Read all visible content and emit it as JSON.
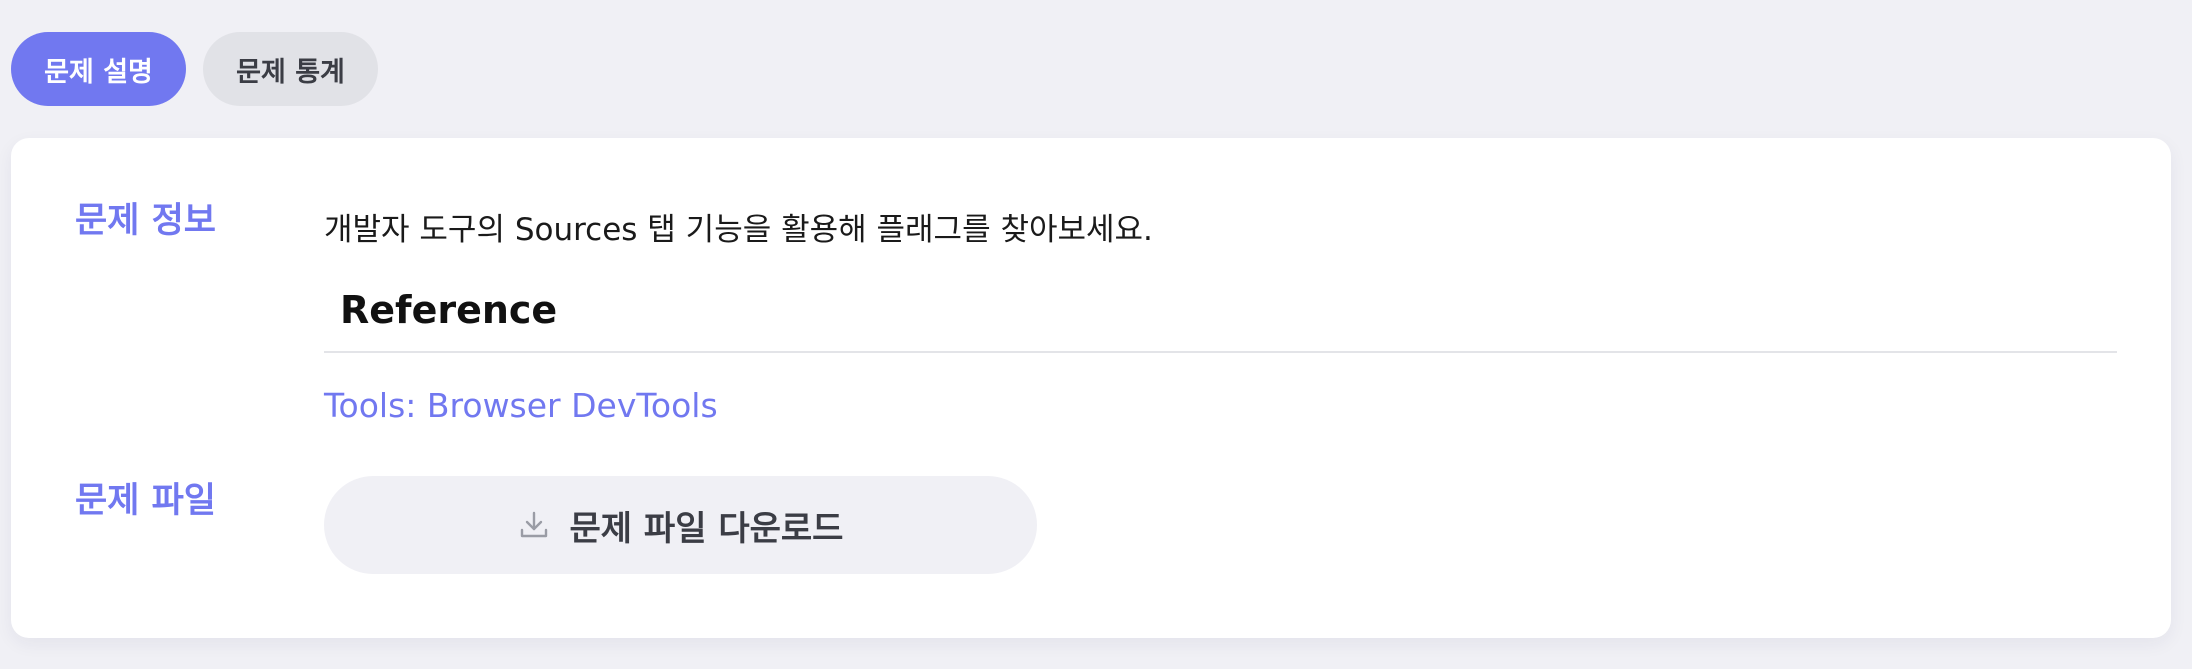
{
  "tabs": [
    {
      "label": "문제 설명",
      "active": true
    },
    {
      "label": "문제 통계",
      "active": false
    }
  ],
  "info": {
    "label": "문제 정보",
    "description": "개발자 도구의 Sources 탭 기능을 활용해 플래그를 찾아보세요.",
    "reference_heading": "Reference",
    "reference_link": "Tools: Browser DevTools"
  },
  "file": {
    "label": "문제 파일",
    "download_label": "문제 파일 다운로드",
    "download_icon": "download-icon"
  },
  "colors": {
    "accent": "#7178f0",
    "tab_inactive_bg": "#e1e2e7",
    "page_bg": "#f0f0f5",
    "card_bg": "#ffffff"
  }
}
